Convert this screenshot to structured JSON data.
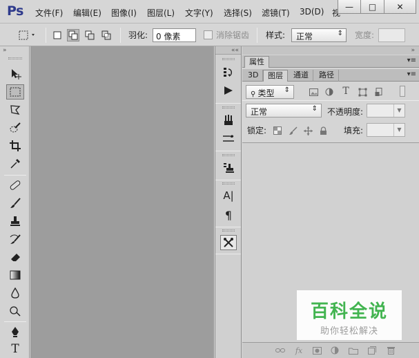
{
  "app": {
    "logo": "Ps",
    "menu": [
      "文件(F)",
      "编辑(E)",
      "图像(I)",
      "图层(L)",
      "文字(Y)",
      "选择(S)",
      "滤镜(T)",
      "3D(D)",
      "视"
    ],
    "window_buttons": {
      "minimize": "—",
      "maximize": "□",
      "close": "✕"
    }
  },
  "options": {
    "feather_label": "羽化:",
    "feather_value": "0 像素",
    "antialias_label": "消除锯齿",
    "style_label": "样式:",
    "style_value": "正常",
    "width_label": "宽度:"
  },
  "tools": {
    "collapse": "»",
    "items": [
      "move-tool",
      "rect-marquee-tool",
      "lasso-tool",
      "quick-select-tool",
      "crop-tool",
      "eyedropper-tool",
      "healing-brush-tool",
      "brush-tool",
      "clone-stamp-tool",
      "history-brush-tool",
      "eraser-tool",
      "gradient-tool",
      "blur-tool",
      "dodge-tool",
      "pen-tool",
      "type-tool"
    ],
    "type_glyph": "T"
  },
  "midbar": {
    "collapse": "««",
    "type_glyph": "A|",
    "paragraph_glyph": "¶"
  },
  "panel": {
    "collapse": "»",
    "properties_tab": "属性",
    "tabs": [
      "3D",
      "图层",
      "通道",
      "路径"
    ],
    "active_tab": "图层",
    "filter_value": "类型",
    "blend_value": "正常",
    "opacity_label": "不透明度:",
    "lock_label": "锁定:",
    "fill_label": "填充:",
    "fx": "fx"
  },
  "watermark": {
    "title": "百科全说",
    "subtitle": "助你轻松解决"
  },
  "colors": {
    "logo": "#2f3b8c",
    "canvas": "#9d9d9d",
    "watermark_green": "#3bb34a"
  }
}
